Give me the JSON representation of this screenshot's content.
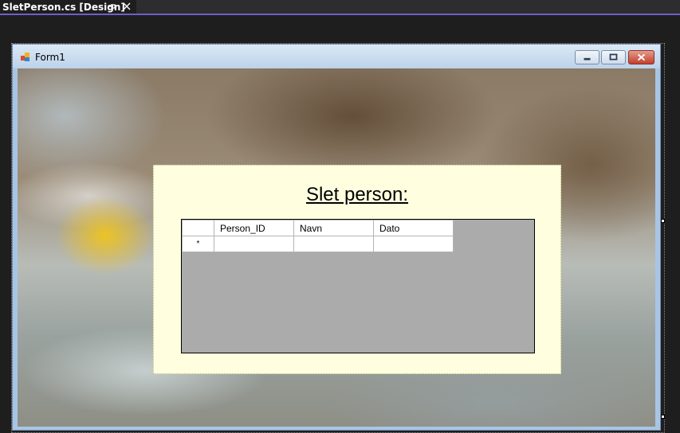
{
  "ide_tab": {
    "title": "SletPerson.cs [Design]",
    "pin_icon": "pin-icon",
    "close_icon": "close-icon"
  },
  "form": {
    "title": "Form1",
    "icon": "form-app-icon",
    "caption_buttons": [
      "minimize-icon",
      "maximize-icon",
      "close-icon"
    ],
    "background": "blurred-street-photo"
  },
  "panel": {
    "heading": "Slet person:",
    "color": "#ffffe0"
  },
  "grid": {
    "columns": [
      "Person_ID",
      "Navn",
      "Dato"
    ],
    "new_row_marker": "*",
    "rows": [
      [
        "",
        "",
        ""
      ]
    ],
    "background_color": "#ababab"
  },
  "colors": {
    "accent_tab_underline": "#6f5fc9",
    "ide_background": "#1e1e1e"
  }
}
